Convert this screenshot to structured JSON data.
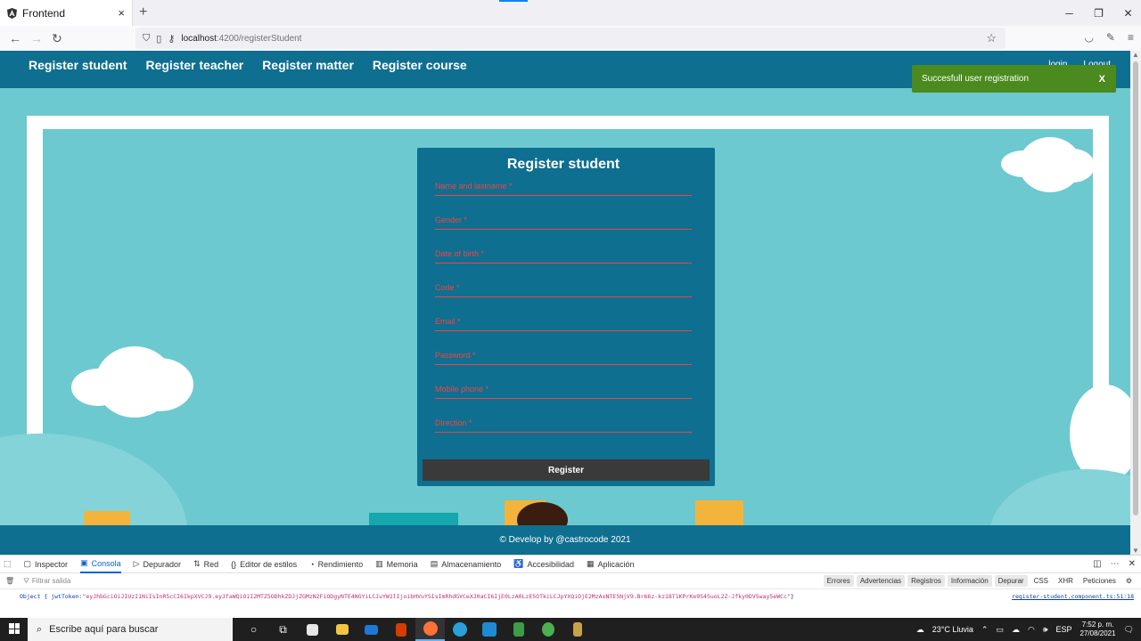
{
  "browser": {
    "tab_title": "Frontend",
    "tab_close": "×",
    "new_tab": "+",
    "url_host": "localhost",
    "url_path": ":4200/registerStudent",
    "win_minimize": "─",
    "win_restore": "❐",
    "win_close": "✕"
  },
  "header": {
    "nav": [
      "Register student",
      "Register teacher",
      "Register matter",
      "Register course"
    ],
    "login": "login",
    "logout": "Logout"
  },
  "toast": {
    "message": "Succesfull user registration",
    "close": "X"
  },
  "form": {
    "title": "Register student",
    "fields": [
      "Name and lastname *",
      "Gender *",
      "Date of birth *",
      "Code *",
      "Email *",
      "Password *",
      "Mobile phone *",
      "Direction *"
    ],
    "submit_label": "Register"
  },
  "footer": {
    "text": "© Develop by @castrocode 2021"
  },
  "devtools": {
    "tabs": [
      "Inspector",
      "Consola",
      "Depurador",
      "Red",
      "Editor de estilos",
      "Rendimiento",
      "Memoria",
      "Almacenamiento",
      "Accesibilidad",
      "Aplicación"
    ],
    "active_tab": "Consola",
    "filter_placeholder": "Filtrar salida",
    "levels": [
      "Errores",
      "Advertencias",
      "Registros",
      "Información",
      "Depurar"
    ],
    "net_filters": [
      "CSS",
      "XHR",
      "Peticiones"
    ],
    "log_prefix": "Object { jwtToken: ",
    "log_token": "\"eyJhbGciOiJIUzI1NiIsInR5cCI6IkpXVCJ9.eyJfaWQiOiI2MTZ5ODhkZDJjZGMzN2FiODgyNTE4NGYiLCJuYW1lIjoibHVuYSIsImRhdGVCeXJ0aCI6IjE0LzA0LzE5OTkiLCJpYXQiOjE2MzAxNTE5NjV9.Br66z-kz18T1KPrKe9S45uoL2Z-Jfky0DV5way5eWCc\"",
    "log_suffix": " }",
    "log_source": "register-student.component.ts:51:18"
  },
  "taskbar": {
    "search_placeholder": "Escribe aquí para buscar",
    "weather": "23°C  Lluvia",
    "lang": "ESP",
    "time": "7:52 p. m.",
    "date": "27/08/2021"
  }
}
